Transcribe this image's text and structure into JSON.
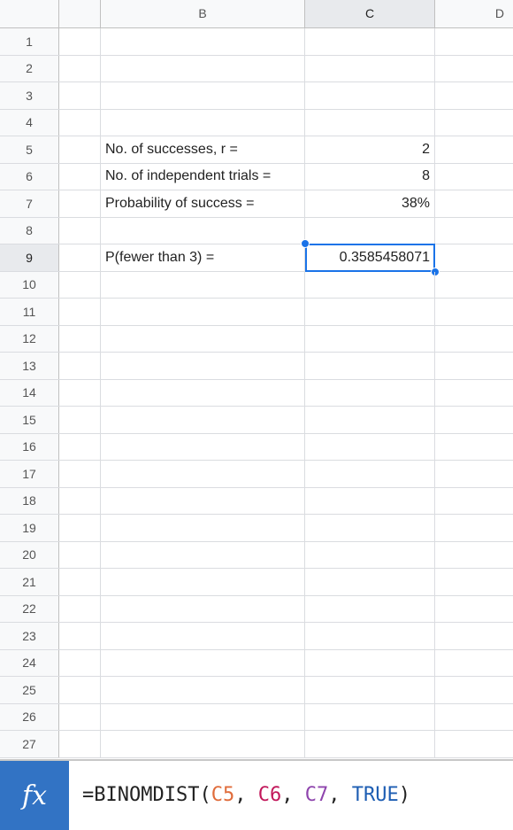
{
  "columns": [
    "B",
    "C",
    "D"
  ],
  "rows": [
    {
      "num": "1",
      "b": "",
      "c": ""
    },
    {
      "num": "2",
      "b": "",
      "c": ""
    },
    {
      "num": "3",
      "b": "",
      "c": ""
    },
    {
      "num": "4",
      "b": "",
      "c": ""
    },
    {
      "num": "5",
      "b": "No. of successes, r =",
      "c": "2"
    },
    {
      "num": "6",
      "b": "No. of independent trials =",
      "c": "8"
    },
    {
      "num": "7",
      "b": "Probability of success =",
      "c": "38%"
    },
    {
      "num": "8",
      "b": "",
      "c": ""
    },
    {
      "num": "9",
      "b": "P(fewer than 3) =",
      "c": "0.3585458071"
    },
    {
      "num": "10",
      "b": "",
      "c": ""
    },
    {
      "num": "11",
      "b": "",
      "c": ""
    },
    {
      "num": "12",
      "b": "",
      "c": ""
    },
    {
      "num": "13",
      "b": "",
      "c": ""
    },
    {
      "num": "14",
      "b": "",
      "c": ""
    },
    {
      "num": "15",
      "b": "",
      "c": ""
    },
    {
      "num": "16",
      "b": "",
      "c": ""
    },
    {
      "num": "17",
      "b": "",
      "c": ""
    },
    {
      "num": "18",
      "b": "",
      "c": ""
    },
    {
      "num": "19",
      "b": "",
      "c": ""
    },
    {
      "num": "20",
      "b": "",
      "c": ""
    },
    {
      "num": "21",
      "b": "",
      "c": ""
    },
    {
      "num": "22",
      "b": "",
      "c": ""
    },
    {
      "num": "23",
      "b": "",
      "c": ""
    },
    {
      "num": "24",
      "b": "",
      "c": ""
    },
    {
      "num": "25",
      "b": "",
      "c": ""
    },
    {
      "num": "26",
      "b": "",
      "c": ""
    },
    {
      "num": "27",
      "b": "",
      "c": ""
    }
  ],
  "selected": {
    "column": "C",
    "row": "9"
  },
  "formula_bar": {
    "icon": "fx-icon",
    "icon_text": "fx",
    "prefix": "=BINOMDIST(",
    "arg1": "C5",
    "sep1": ", ",
    "arg2": "C6",
    "sep2": ", ",
    "arg3": "C7",
    "sep3": ", ",
    "arg4": "TRUE",
    "suffix": ")"
  },
  "colors": {
    "selection": "#1a73e8",
    "fx_button": "#3273c4",
    "ref1": "#e06c3b",
    "ref2": "#c2185b",
    "ref3": "#8e44ad",
    "keyword": "#1e5eb3"
  }
}
